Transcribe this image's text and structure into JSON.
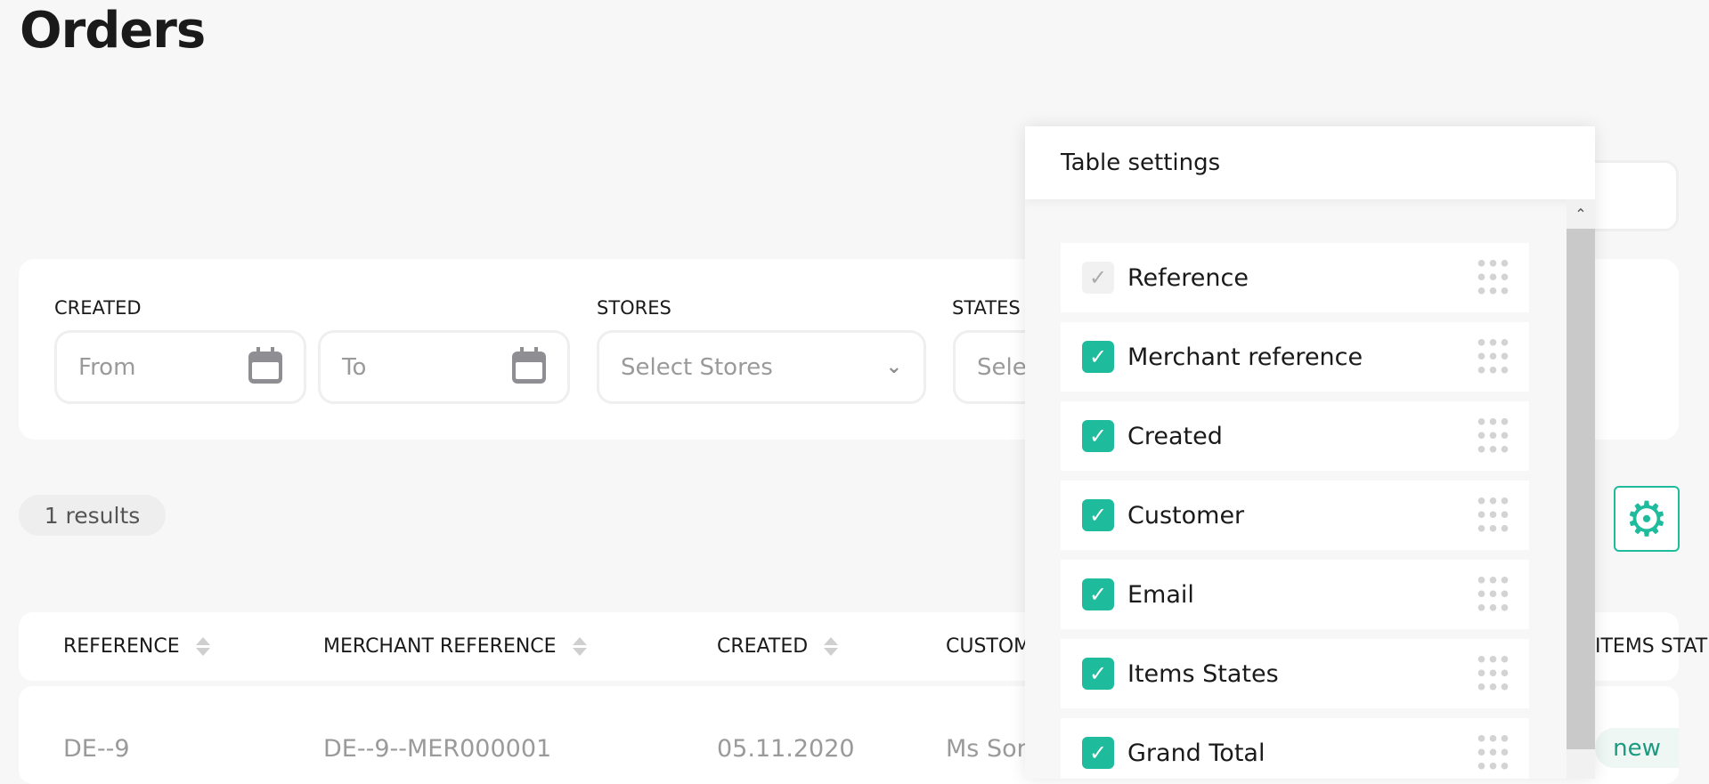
{
  "page": {
    "title": "Orders"
  },
  "filters": {
    "created_label": "CREATED",
    "from_placeholder": "From",
    "to_placeholder": "To",
    "stores_label": "STORES",
    "stores_placeholder": "Select Stores",
    "states_label": "STATES",
    "states_placeholder": "Select States"
  },
  "results": {
    "count_label": "1 results"
  },
  "table": {
    "columns": [
      "REFERENCE",
      "MERCHANT REFERENCE",
      "CREATED",
      "CUSTOMER",
      "ITEMS STATES"
    ],
    "rows": [
      {
        "reference": "DE--9",
        "merchant_reference": "DE--9--MER000001",
        "created": "05.11.2020",
        "customer": "Ms Sonia",
        "items_state": "new"
      }
    ]
  },
  "settings": {
    "title": "Table settings",
    "items": [
      {
        "label": "Reference",
        "checked": true,
        "disabled": true
      },
      {
        "label": "Merchant reference",
        "checked": true
      },
      {
        "label": "Created",
        "checked": true
      },
      {
        "label": "Customer",
        "checked": true
      },
      {
        "label": "Email",
        "checked": true
      },
      {
        "label": "Items States",
        "checked": true
      },
      {
        "label": "Grand Total",
        "checked": true
      }
    ]
  },
  "colors": {
    "accent": "#1ebc9c",
    "background": "#f7f7f7"
  }
}
